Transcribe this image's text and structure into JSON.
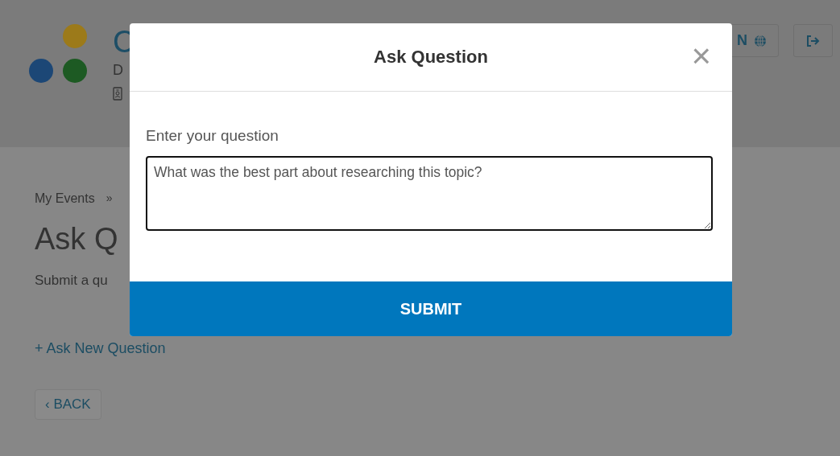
{
  "header": {
    "title": "C",
    "subtitle": "D",
    "language_button": "N"
  },
  "breadcrumb": {
    "items": [
      "My Events"
    ],
    "separator": "»"
  },
  "page": {
    "title": "Ask Q",
    "description": "Submit a qu",
    "ask_link": "+ Ask New Question",
    "back_button": "‹ BACK"
  },
  "modal": {
    "title": "Ask Question",
    "close": "×",
    "label": "Enter your question",
    "value": "What was the best part about researching this topic?",
    "submit": "SUBMIT"
  }
}
